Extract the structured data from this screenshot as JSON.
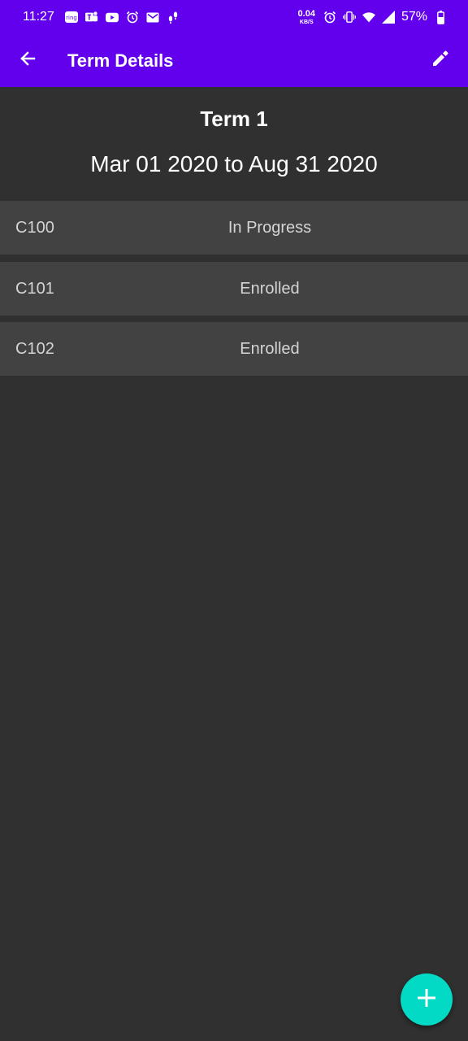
{
  "status_bar": {
    "time": "11:27",
    "net_speed_value": "0.04",
    "net_speed_unit": "KB/S",
    "battery_percent": "57%",
    "left_icons": [
      "ring-icon",
      "teams-icon",
      "youtube-icon",
      "alarm-icon",
      "gmail-icon",
      "footsteps-icon"
    ],
    "right_icons": [
      "alarm-icon",
      "vibrate-icon",
      "wifi-icon",
      "signal-icon",
      "battery-icon"
    ]
  },
  "app_bar": {
    "title": "Term Details",
    "back_icon": "arrow-back-icon",
    "edit_icon": "pencil-icon",
    "color": "#6200ee"
  },
  "term": {
    "title": "Term 1",
    "dates": "Mar 01 2020 to Aug 31 2020"
  },
  "courses": [
    {
      "code": "C100",
      "status": "In Progress"
    },
    {
      "code": "C101",
      "status": "Enrolled"
    },
    {
      "code": "C102",
      "status": "Enrolled"
    }
  ],
  "fab": {
    "icon": "plus-icon",
    "color": "#03dac5"
  },
  "colors": {
    "background": "#303030",
    "row_background": "#424242",
    "accent": "#6200ee"
  }
}
